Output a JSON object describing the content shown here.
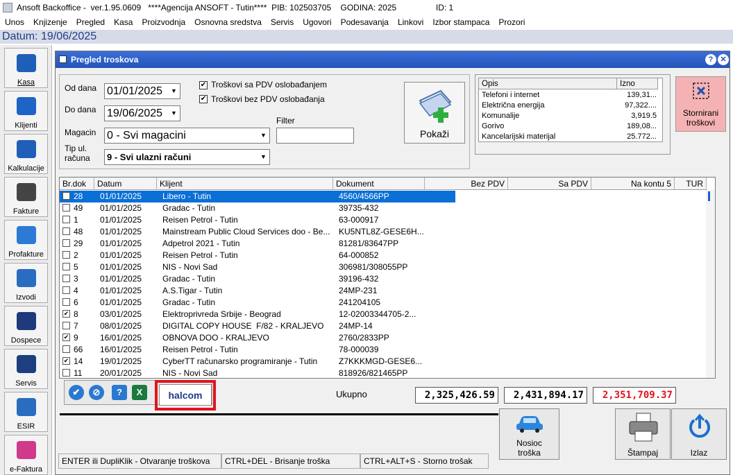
{
  "app": {
    "title": "Ansoft Backoffice -  ver.1.95.0609   ****Agencija ANSOFT - Tutin****  PIB: 102503705    GODINA: 2025                 ID: 1",
    "menu": [
      "Unos",
      "Knjizenje",
      "Pregled",
      "Kasa",
      "Proizvodnja",
      "Osnovna sredstva",
      "Servis",
      "Ugovori",
      "Podesavanja",
      "Linkovi",
      "Izbor stampaca",
      "Prozori"
    ],
    "datum": "Datum: 19/06/2025"
  },
  "sidebar": [
    {
      "label": "Kasa",
      "icon": "cart-icon"
    },
    {
      "label": "Klijenti",
      "icon": "people-icon"
    },
    {
      "label": "Kalkulacije",
      "icon": "calculator-icon"
    },
    {
      "label": "Fakture",
      "icon": "invoice-icon"
    },
    {
      "label": "Profakture",
      "icon": "proforma-icon"
    },
    {
      "label": "Izvodi",
      "icon": "bank-statement-icon"
    },
    {
      "label": "Dospece",
      "icon": "calendar-icon"
    },
    {
      "label": "Servis",
      "icon": "tools-icon"
    },
    {
      "label": "ESIR",
      "icon": "esir-icon"
    },
    {
      "label": "e-Faktura",
      "icon": "efaktura-icon"
    }
  ],
  "window": {
    "title": "Pregled troskova",
    "help": "?",
    "close": "✕"
  },
  "filters": {
    "od_label": "Od dana",
    "od_value": "01/01/2025",
    "do_label": "Do dana",
    "do_value": "19/06/2025",
    "magacin_label": "Magacin",
    "magacin_value": "0 - Svi magacini",
    "tip_label": "Tip ul.\nračuna",
    "tip_value": "9 - Svi ulazni računi",
    "chk1": "Troškovi sa PDV oslobađanjem",
    "chk2": "Troškovi bez PDV oslobađanja",
    "filter_label": "Filter",
    "filter_value": "",
    "pokazi": "Pokaži"
  },
  "opis": {
    "headers": [
      "Opis",
      "Izno"
    ],
    "rows": [
      [
        "Telefoni i internet",
        "139,31..."
      ],
      [
        "Električna energija",
        "97,322...."
      ],
      [
        "Komunalije",
        "3,919.5"
      ],
      [
        "Gorivo",
        "189,08..."
      ],
      [
        "Kancelarijski materijal",
        "25.772..."
      ]
    ]
  },
  "storno": "Stornirani\ntroškovi",
  "grid": {
    "headers": [
      "Br.dok",
      "Datum",
      "Klijent",
      "Dokument",
      "Bez PDV",
      "Sa PDV",
      "Na kontu 5",
      "TUR"
    ],
    "rows": [
      {
        "chk": false,
        "br": "28",
        "datum": "01/01/2025",
        "klijent": "Libero - Tutin",
        "dok": "4560/4566PP",
        "sel": true
      },
      {
        "chk": false,
        "br": "49",
        "datum": "01/01/2025",
        "klijent": "Gradac - Tutin",
        "dok": "39735-432"
      },
      {
        "chk": false,
        "br": "1",
        "datum": "01/01/2025",
        "klijent": "Reisen Petrol - Tutin",
        "dok": "63-000917"
      },
      {
        "chk": false,
        "br": "48",
        "datum": "01/01/2025",
        "klijent": "Mainstream Public Cloud Services doo - Be...",
        "dok": "KU5NTL8Z-GESE6H..."
      },
      {
        "chk": false,
        "br": "29",
        "datum": "01/01/2025",
        "klijent": "Adpetrol 2021 - Tutin",
        "dok": "81281/83647PP"
      },
      {
        "chk": false,
        "br": "2",
        "datum": "01/01/2025",
        "klijent": "Reisen Petrol - Tutin",
        "dok": "64-000852"
      },
      {
        "chk": false,
        "br": "5",
        "datum": "01/01/2025",
        "klijent": "NIS - Novi Sad",
        "dok": "306981/308055PP"
      },
      {
        "chk": false,
        "br": "3",
        "datum": "01/01/2025",
        "klijent": "Gradac - Tutin",
        "dok": "39196-432"
      },
      {
        "chk": false,
        "br": "4",
        "datum": "01/01/2025",
        "klijent": "A.S.Tigar - Tutin",
        "dok": "24MP-231"
      },
      {
        "chk": false,
        "br": "6",
        "datum": "01/01/2025",
        "klijent": "Gradac - Tutin",
        "dok": "241204105"
      },
      {
        "chk": true,
        "br": "8",
        "datum": "03/01/2025",
        "klijent": "Elektroprivreda Srbije - Beograd",
        "dok": "12-02003344705-2..."
      },
      {
        "chk": false,
        "br": "7",
        "datum": "08/01/2025",
        "klijent": "DIGITAL COPY HOUSE  F/82 - KRALJEVO",
        "dok": "24MP-14"
      },
      {
        "chk": true,
        "br": "9",
        "datum": "16/01/2025",
        "klijent": "OBNOVA DOO - KRALJEVO",
        "dok": "2760/2833PP"
      },
      {
        "chk": false,
        "br": "66",
        "datum": "16/01/2025",
        "klijent": "Reisen Petrol - Tutin",
        "dok": "78-000039"
      },
      {
        "chk": true,
        "br": "14",
        "datum": "19/01/2025",
        "klijent": "CyberTT računarsko programiranje - Tutin",
        "dok": "Z7KKKMGD-GESE6..."
      },
      {
        "chk": false,
        "br": "11",
        "datum": "20/01/2025",
        "klijent": "NIS - Novi Sad",
        "dok": "818926/821465PP"
      }
    ]
  },
  "totals": {
    "label": "Ukupno",
    "bez": "2,325,426.59",
    "sa": "2,431,894.17",
    "konto": "2,351,709.37",
    "konto_color": "#e1141d"
  },
  "halcom": "halcom",
  "buttons": {
    "nosioc": "Nosioc\ntroška",
    "stampaj": "Štampaj",
    "izlaz": "Izlaz"
  },
  "status": [
    "ENTER ili DupliKlik - Otvaranje troškova",
    "CTRL+DEL - Brisanje troška",
    "CTRL+ALT+S - Storno trošak"
  ]
}
